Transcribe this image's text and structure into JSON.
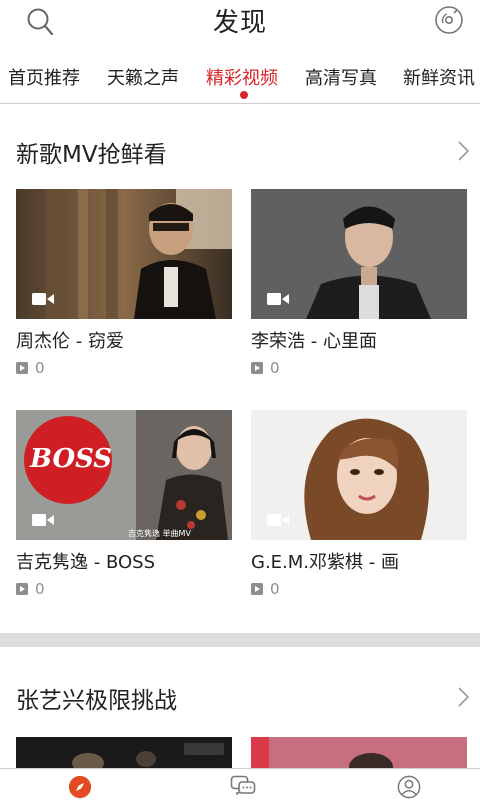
{
  "header": {
    "title": "发现"
  },
  "tabs": [
    {
      "label": "首页推荐",
      "active": false
    },
    {
      "label": "天籁之声",
      "active": false
    },
    {
      "label": "精彩视频",
      "active": true
    },
    {
      "label": "高清写真",
      "active": false
    },
    {
      "label": "新鲜资讯",
      "active": false
    }
  ],
  "sections": [
    {
      "title": "新歌MV抢鲜看",
      "items": [
        {
          "title": "周杰伦 - 窃爱",
          "plays": "0"
        },
        {
          "title": "李荣浩 - 心里面",
          "plays": "0"
        },
        {
          "title": "吉克隽逸 - BOSS",
          "plays": "0",
          "thumb_text": "BOSS",
          "thumb_caption": "吉克隽逸 单曲MV"
        },
        {
          "title": "G.E.M.邓紫棋 - 画",
          "plays": "0"
        }
      ]
    },
    {
      "title": "张艺兴极限挑战"
    }
  ],
  "bottom_nav": [
    {
      "icon": "compass-icon",
      "active": true
    },
    {
      "icon": "chat-icon",
      "active": false
    },
    {
      "icon": "profile-icon",
      "active": false
    }
  ],
  "colors": {
    "accent": "#d8242a",
    "text": "#222222",
    "muted": "#8e8e8e",
    "divider": "#dcdcdc"
  }
}
